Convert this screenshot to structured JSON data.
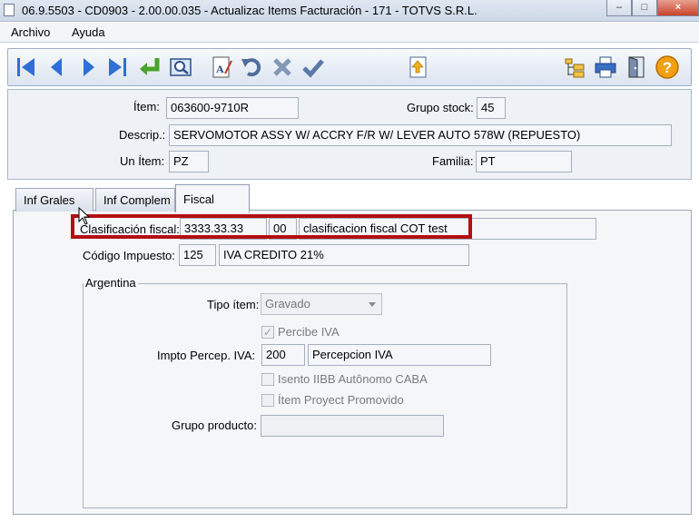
{
  "window": {
    "title": "06.9.5503 - CD0903 - 2.00.00.035 - Actualizac Items Facturación - 171 - TOTVS S.R.L."
  },
  "menu": {
    "items": [
      "Archivo",
      "Ayuda"
    ]
  },
  "toolbar": {
    "icons": [
      "first-icon",
      "prev-icon",
      "next-icon",
      "last-icon",
      "goto-icon",
      "search-icon",
      "spellcheck-icon",
      "undo-icon",
      "cancel-icon",
      "confirm-icon",
      "upload-icon",
      "tree-icon",
      "print-icon",
      "exit-icon",
      "help-icon"
    ],
    "help_symbol": "?"
  },
  "header": {
    "item_label": "Ítem:",
    "item_value": "063600-9710R",
    "group_stock_label": "Grupo stock:",
    "group_stock_value": "45",
    "descrip_label": "Descrip.:",
    "descrip_value": "SERVOMOTOR ASSY W/ ACCRY F/R W/ LEVER AUTO 578W (REPUESTO)",
    "unit_label": "Un Ítem:",
    "unit_value": "PZ",
    "family_label": "Familia:",
    "family_value": "PT"
  },
  "tabs": [
    {
      "label": "Inf Grales",
      "active": false
    },
    {
      "label": "Inf Complem",
      "active": false
    },
    {
      "label": "Fiscal",
      "active": true
    }
  ],
  "fiscal": {
    "clasif_label": "Clasificación fiscal:",
    "clasif_code": "3333.33.33",
    "clasif_sub": "00",
    "clasif_desc": "clasificacion fiscal COT test",
    "impuesto_label": "Código Impuesto:",
    "impuesto_code": "125",
    "impuesto_desc": "IVA CREDITO 21%",
    "group_title": "Argentina",
    "tipo_item_label": "Tipo ítem:",
    "tipo_item_value": "Gravado",
    "percibe_iva_label": "Percibe IVA",
    "percibe_iva_checked": true,
    "check_mark": "✓",
    "impto_percep_label": "Impto Percep. IVA:",
    "impto_percep_code": "200",
    "impto_percep_desc": "Percepcion IVA",
    "isento_label": "Isento IIBB Autônomo CABA",
    "proyect_label": "Ítem Proyect Promovido",
    "grupo_producto_label": "Grupo producto:",
    "grupo_producto_value": ""
  },
  "colors": {
    "highlight": "#b30f12",
    "toolbar_blue": "#2f6fd6",
    "help_orange": "#f0a010"
  }
}
